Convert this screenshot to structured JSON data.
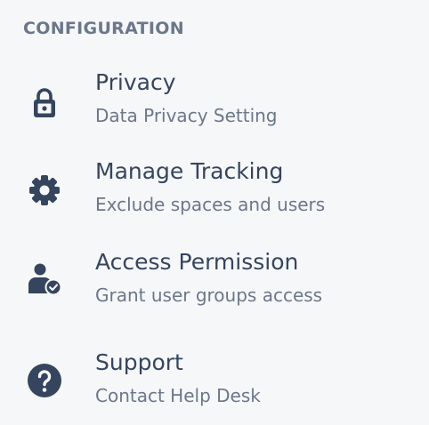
{
  "section": {
    "title": "CONFIGURATION"
  },
  "items": [
    {
      "label": "Privacy",
      "description": "Data Privacy Setting",
      "icon": "lock-icon"
    },
    {
      "label": "Manage Tracking",
      "description": "Exclude spaces and users",
      "icon": "gear-icon"
    },
    {
      "label": "Access Permission",
      "description": "Grant user groups access",
      "icon": "user-check-icon"
    },
    {
      "label": "Support",
      "description": "Contact Help Desk",
      "icon": "question-circle-icon"
    }
  ],
  "colors": {
    "background": "#f6f7f9",
    "icon": "#36455e",
    "label": "#36455e",
    "muted": "#6b778a"
  }
}
